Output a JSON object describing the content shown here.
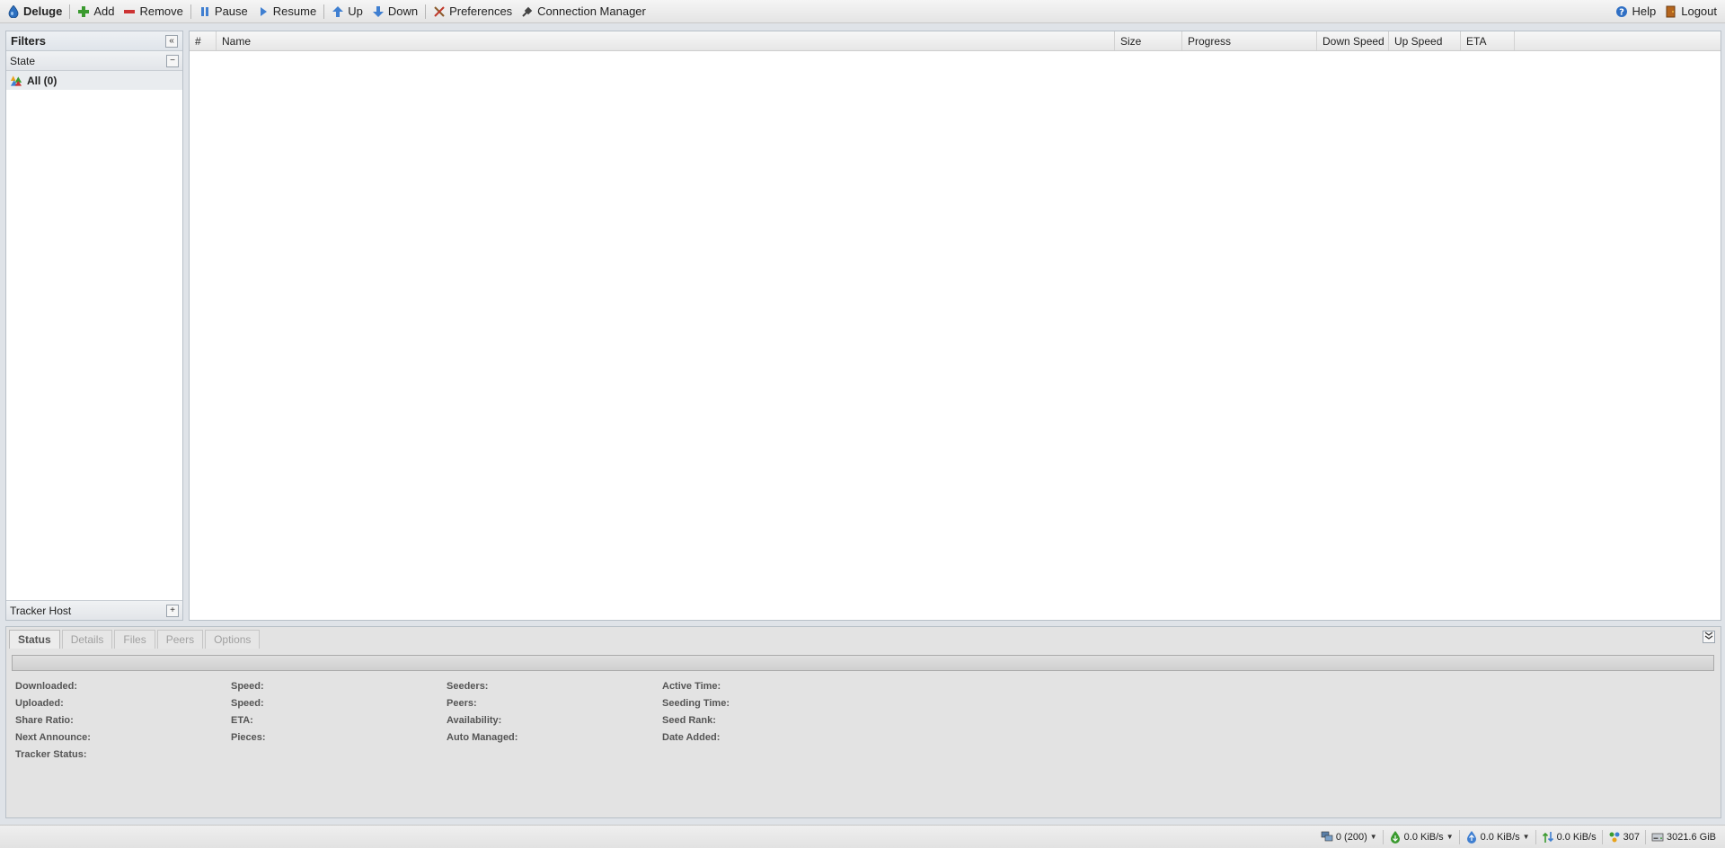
{
  "toolbar": {
    "brand": "Deluge",
    "add": "Add",
    "remove": "Remove",
    "pause": "Pause",
    "resume": "Resume",
    "up": "Up",
    "down": "Down",
    "preferences": "Preferences",
    "connection_manager": "Connection Manager",
    "help": "Help",
    "logout": "Logout"
  },
  "filters": {
    "title": "Filters",
    "state_group": "State",
    "all_item": "All (0)",
    "tracker_group": "Tracker Host",
    "collapse_symbol": "«",
    "state_toggle": "−",
    "tracker_toggle": "+"
  },
  "grid": {
    "columns": [
      "#",
      "Name",
      "Size",
      "Progress",
      "Down Speed",
      "Up Speed",
      "ETA"
    ]
  },
  "details": {
    "tabs": [
      "Status",
      "Details",
      "Files",
      "Peers",
      "Options"
    ],
    "active_tab": "Status",
    "progress": 0,
    "col1": [
      "Downloaded:",
      "Uploaded:",
      "Share Ratio:",
      "Next Announce:",
      "Tracker Status:"
    ],
    "col2": [
      "Speed:",
      "Speed:",
      "ETA:",
      "Pieces:"
    ],
    "col3": [
      "Seeders:",
      "Peers:",
      "Availability:",
      "Auto Managed:"
    ],
    "col4": [
      "Active Time:",
      "Seeding Time:",
      "Seed Rank:",
      "Date Added:"
    ]
  },
  "statusbar": {
    "connections": "0 (200)",
    "download_speed": "0.0 KiB/s",
    "upload_speed": "0.0 KiB/s",
    "protocol_traffic": "0.0 KiB/s",
    "dht_nodes": "307",
    "free_space": "3021.6 GiB"
  },
  "colors": {
    "add_green": "#3a9a2f",
    "remove_red": "#cc3333",
    "arrow_blue": "#3f7fd1",
    "help_blue": "#2f6fc4"
  }
}
